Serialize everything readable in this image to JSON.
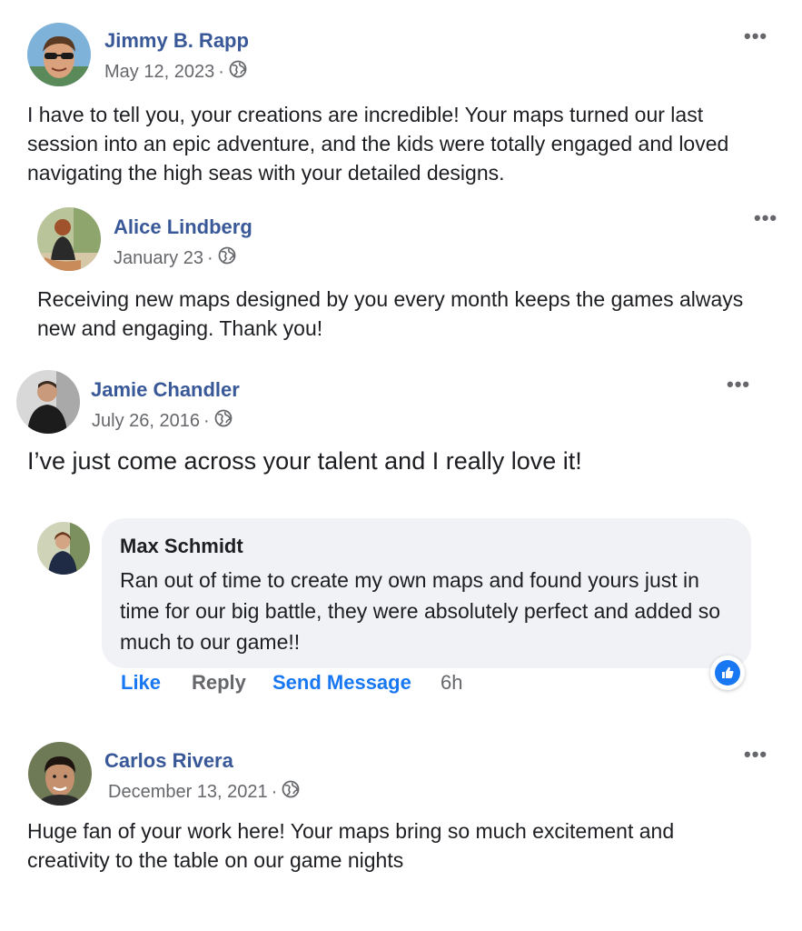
{
  "comments": [
    {
      "author": "Jimmy B. Rapp",
      "date": "May 12, 2023",
      "separator": "·",
      "visibility_icon": "globe-icon",
      "more_label": "•••",
      "text": "I have to tell you, your creations are incredible! Your maps turned our last session into an epic adventure, and the kids were totally engaged and loved navigating the high seas with your detailed designs."
    },
    {
      "author": "Alice Lindberg",
      "date": "January 23",
      "separator": "·",
      "visibility_icon": "globe-icon",
      "more_label": "•••",
      "text": "Receiving new maps designed by you every month keeps the games always new and engaging. Thank you!"
    },
    {
      "author": "Jamie Chandler",
      "date": "July 26, 2016",
      "separator": "·",
      "visibility_icon": "globe-icon",
      "more_label": "•••",
      "text": "I’ve just come across your talent and I really love it!"
    },
    {
      "author": "Carlos Rivera",
      "date": "December 13, 2021",
      "separator": "·",
      "visibility_icon": "globe-icon",
      "more_label": "•••",
      "text": "Huge fan of your work here! Your maps bring so much excitement and creativity to the table on our game nights"
    }
  ],
  "reply": {
    "author": "Max Schmidt",
    "text": "Ran out of time to create my own maps and found yours just in time for our big battle, they were absolutely perfect and added so much to our game!!",
    "reaction_icon": "thumbs-up-icon",
    "actions": {
      "like": "Like",
      "reply": "Reply",
      "send_message": "Send Message",
      "time": "6h"
    }
  },
  "colors": {
    "name_link": "#385898",
    "action_blue": "#1877f2",
    "meta_gray": "#65676b",
    "bubble_bg": "#f0f2f5"
  }
}
